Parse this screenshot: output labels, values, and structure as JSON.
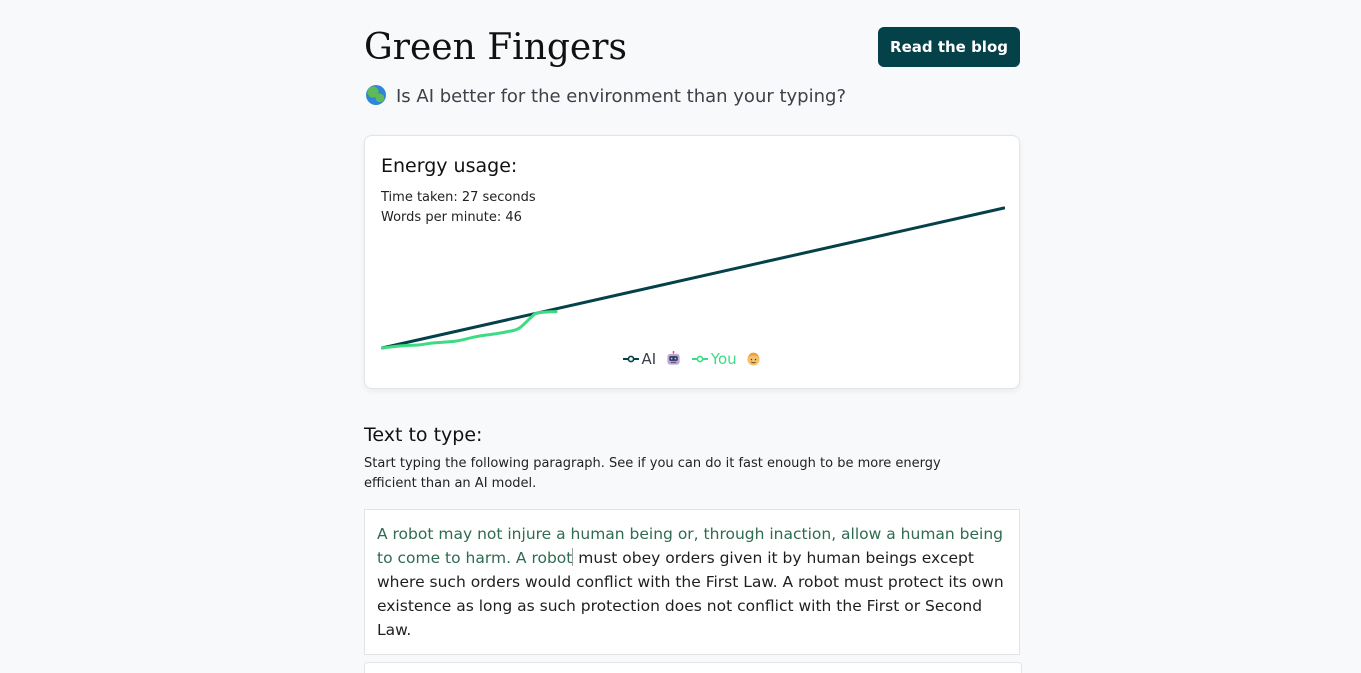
{
  "header": {
    "title": "Green Fingers",
    "blog_button_label": "Read the blog"
  },
  "subtitle": {
    "icon": "globe-icon",
    "text": "Is AI better for the environment than your typing?"
  },
  "energy_card": {
    "title": "Energy usage:",
    "time_taken": "Time taken: 27 seconds",
    "words_per_minute": "Words per minute: 46"
  },
  "chart_data": {
    "type": "line",
    "series": [
      {
        "name": "AI",
        "color": "#054148",
        "icon": "robot-icon",
        "points": [
          [
            0,
            0
          ],
          [
            100,
            100
          ]
        ]
      },
      {
        "name": "You",
        "color": "#3ddc84",
        "icon": "face-icon",
        "points": [
          [
            0,
            0
          ],
          [
            3,
            1.5
          ],
          [
            6,
            2.2
          ],
          [
            8,
            3.5
          ],
          [
            12,
            5
          ],
          [
            15,
            8
          ],
          [
            18,
            10
          ],
          [
            20,
            11.5
          ],
          [
            22,
            14
          ],
          [
            24,
            22
          ],
          [
            25,
            25
          ],
          [
            28,
            26
          ]
        ]
      }
    ],
    "xlim": [
      0,
      100
    ],
    "ylim": [
      0,
      100
    ],
    "grid": false,
    "legend": "bottom-center"
  },
  "typing_section": {
    "title": "Text to type:",
    "instructions": "Start typing the following paragraph. See if you can do it fast enough to be more energy efficient than an AI model.",
    "typed_text": "A robot may not injure a human being or, through inaction, allow a human being to come to harm. A robot",
    "remaining_text": " must obey orders given it by human beings except where such orders would conflict with the First Law. A robot must protect its own existence as long as such protection does not conflict with the First or Second Law."
  },
  "colors": {
    "accent": "#054148",
    "you_line": "#3ddc84",
    "typed_text": "#2f6b4f"
  }
}
